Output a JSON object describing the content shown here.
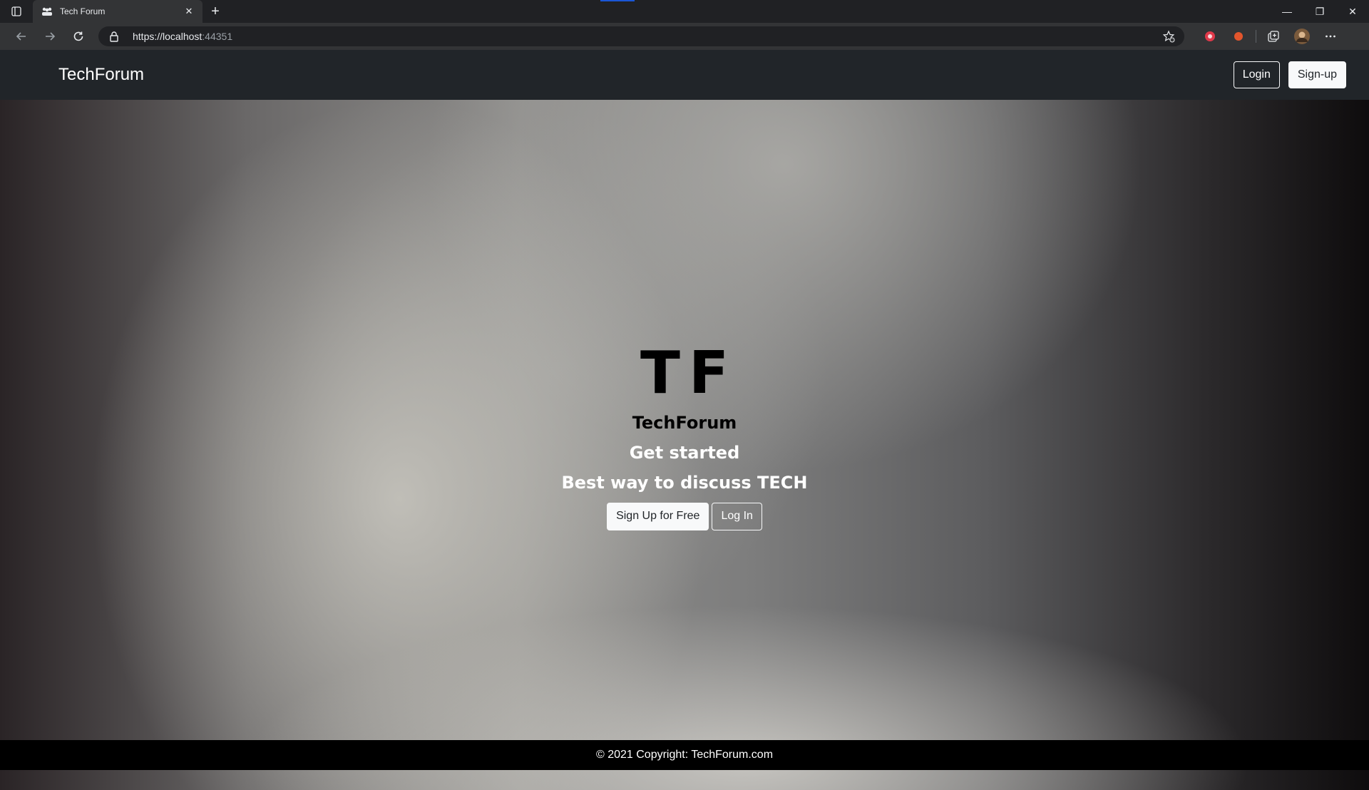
{
  "browser": {
    "tab": {
      "title": "Tech Forum",
      "close_glyph": "✕",
      "favicon": "forum-people-icon"
    },
    "new_tab_glyph": "+",
    "window_controls": {
      "minimize": "—",
      "restore": "❐",
      "close": "✕"
    },
    "address": {
      "host": "https://localhost",
      "port": ":44351"
    },
    "colors": {
      "tab_accent": "#1a56d6",
      "extension_red": "#e0394a",
      "extension_orange": "#e2552c"
    }
  },
  "site": {
    "brand": "TechForum",
    "nav": {
      "login_label": "Login",
      "signup_label": "Sign-up"
    }
  },
  "hero": {
    "logo": "TF",
    "name": "TechForum",
    "lead": "Get started",
    "tagline": "Best way to discuss TECH",
    "signup_label": "Sign Up for Free",
    "login_label": "Log In"
  },
  "footer": {
    "text": "© 2021 Copyright: TechForum.com"
  }
}
